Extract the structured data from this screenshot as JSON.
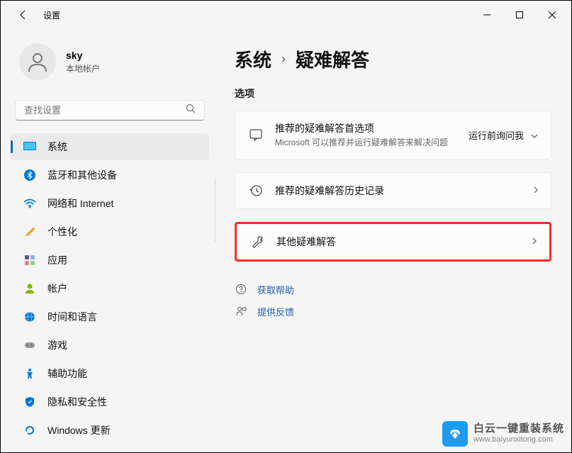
{
  "window": {
    "title": "设置"
  },
  "user": {
    "name": "sky",
    "type": "本地帐户"
  },
  "search": {
    "placeholder": "查找设置"
  },
  "nav": {
    "items": [
      {
        "label": "系统"
      },
      {
        "label": "蓝牙和其他设备"
      },
      {
        "label": "网络和 Internet"
      },
      {
        "label": "个性化"
      },
      {
        "label": "应用"
      },
      {
        "label": "帐户"
      },
      {
        "label": "时间和语言"
      },
      {
        "label": "游戏"
      },
      {
        "label": "辅助功能"
      },
      {
        "label": "隐私和安全性"
      },
      {
        "label": "Windows 更新"
      }
    ]
  },
  "breadcrumb": {
    "root": "系统",
    "sep": "›",
    "current": "疑难解答"
  },
  "section": {
    "options": "选项"
  },
  "cards": {
    "c0": {
      "title": "推荐的疑难解答首选项",
      "sub": "Microsoft 可以推荐并运行疑难解答来解决问题",
      "action": "运行前询问我"
    },
    "c1": {
      "title": "推荐的疑难解答历史记录"
    },
    "c2": {
      "title": "其他疑难解答"
    }
  },
  "links": {
    "help": "获取帮助",
    "feedback": "提供反馈"
  },
  "watermark": {
    "main": "白云一键重装系统",
    "sub": "www.baiyunxitong.com"
  }
}
